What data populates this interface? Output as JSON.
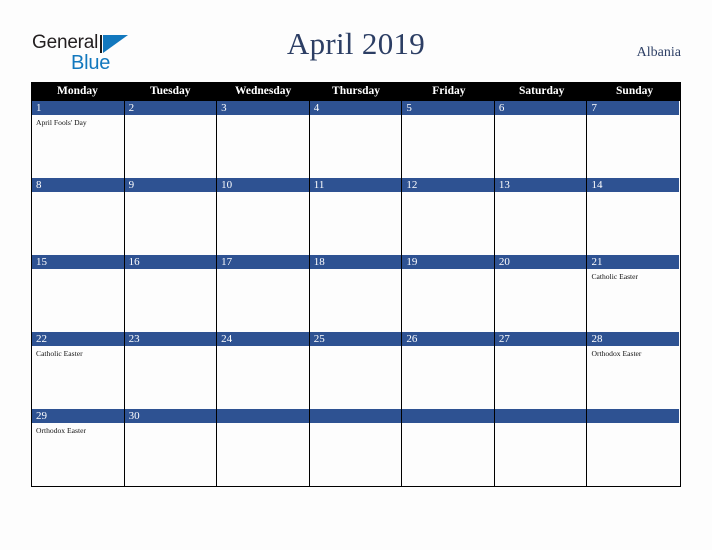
{
  "brand": {
    "name_part1": "General",
    "name_part2": "Blue",
    "mark_icon": "triangle-logo-icon",
    "color_primary": "#1278be",
    "color_text": "#231f20"
  },
  "header": {
    "title": "April 2019",
    "country": "Albania",
    "title_color": "#2c3e64"
  },
  "calendar": {
    "accent_color": "#2e5292",
    "header_bg": "#000000",
    "weekday_headers": [
      "Monday",
      "Tuesday",
      "Wednesday",
      "Thursday",
      "Friday",
      "Saturday",
      "Sunday"
    ],
    "weeks": [
      [
        {
          "day": "1",
          "events": [
            "April Fools' Day"
          ]
        },
        {
          "day": "2",
          "events": []
        },
        {
          "day": "3",
          "events": []
        },
        {
          "day": "4",
          "events": []
        },
        {
          "day": "5",
          "events": []
        },
        {
          "day": "6",
          "events": []
        },
        {
          "day": "7",
          "events": []
        }
      ],
      [
        {
          "day": "8",
          "events": []
        },
        {
          "day": "9",
          "events": []
        },
        {
          "day": "10",
          "events": []
        },
        {
          "day": "11",
          "events": []
        },
        {
          "day": "12",
          "events": []
        },
        {
          "day": "13",
          "events": []
        },
        {
          "day": "14",
          "events": []
        }
      ],
      [
        {
          "day": "15",
          "events": []
        },
        {
          "day": "16",
          "events": []
        },
        {
          "day": "17",
          "events": []
        },
        {
          "day": "18",
          "events": []
        },
        {
          "day": "19",
          "events": []
        },
        {
          "day": "20",
          "events": []
        },
        {
          "day": "21",
          "events": [
            "Catholic Easter"
          ]
        }
      ],
      [
        {
          "day": "22",
          "events": [
            "Catholic Easter"
          ]
        },
        {
          "day": "23",
          "events": []
        },
        {
          "day": "24",
          "events": []
        },
        {
          "day": "25",
          "events": []
        },
        {
          "day": "26",
          "events": []
        },
        {
          "day": "27",
          "events": []
        },
        {
          "day": "28",
          "events": [
            "Orthodox Easter"
          ]
        }
      ],
      [
        {
          "day": "29",
          "events": [
            "Orthodox Easter"
          ]
        },
        {
          "day": "30",
          "events": []
        },
        {
          "day": "",
          "events": []
        },
        {
          "day": "",
          "events": []
        },
        {
          "day": "",
          "events": []
        },
        {
          "day": "",
          "events": []
        },
        {
          "day": "",
          "events": []
        }
      ]
    ]
  }
}
